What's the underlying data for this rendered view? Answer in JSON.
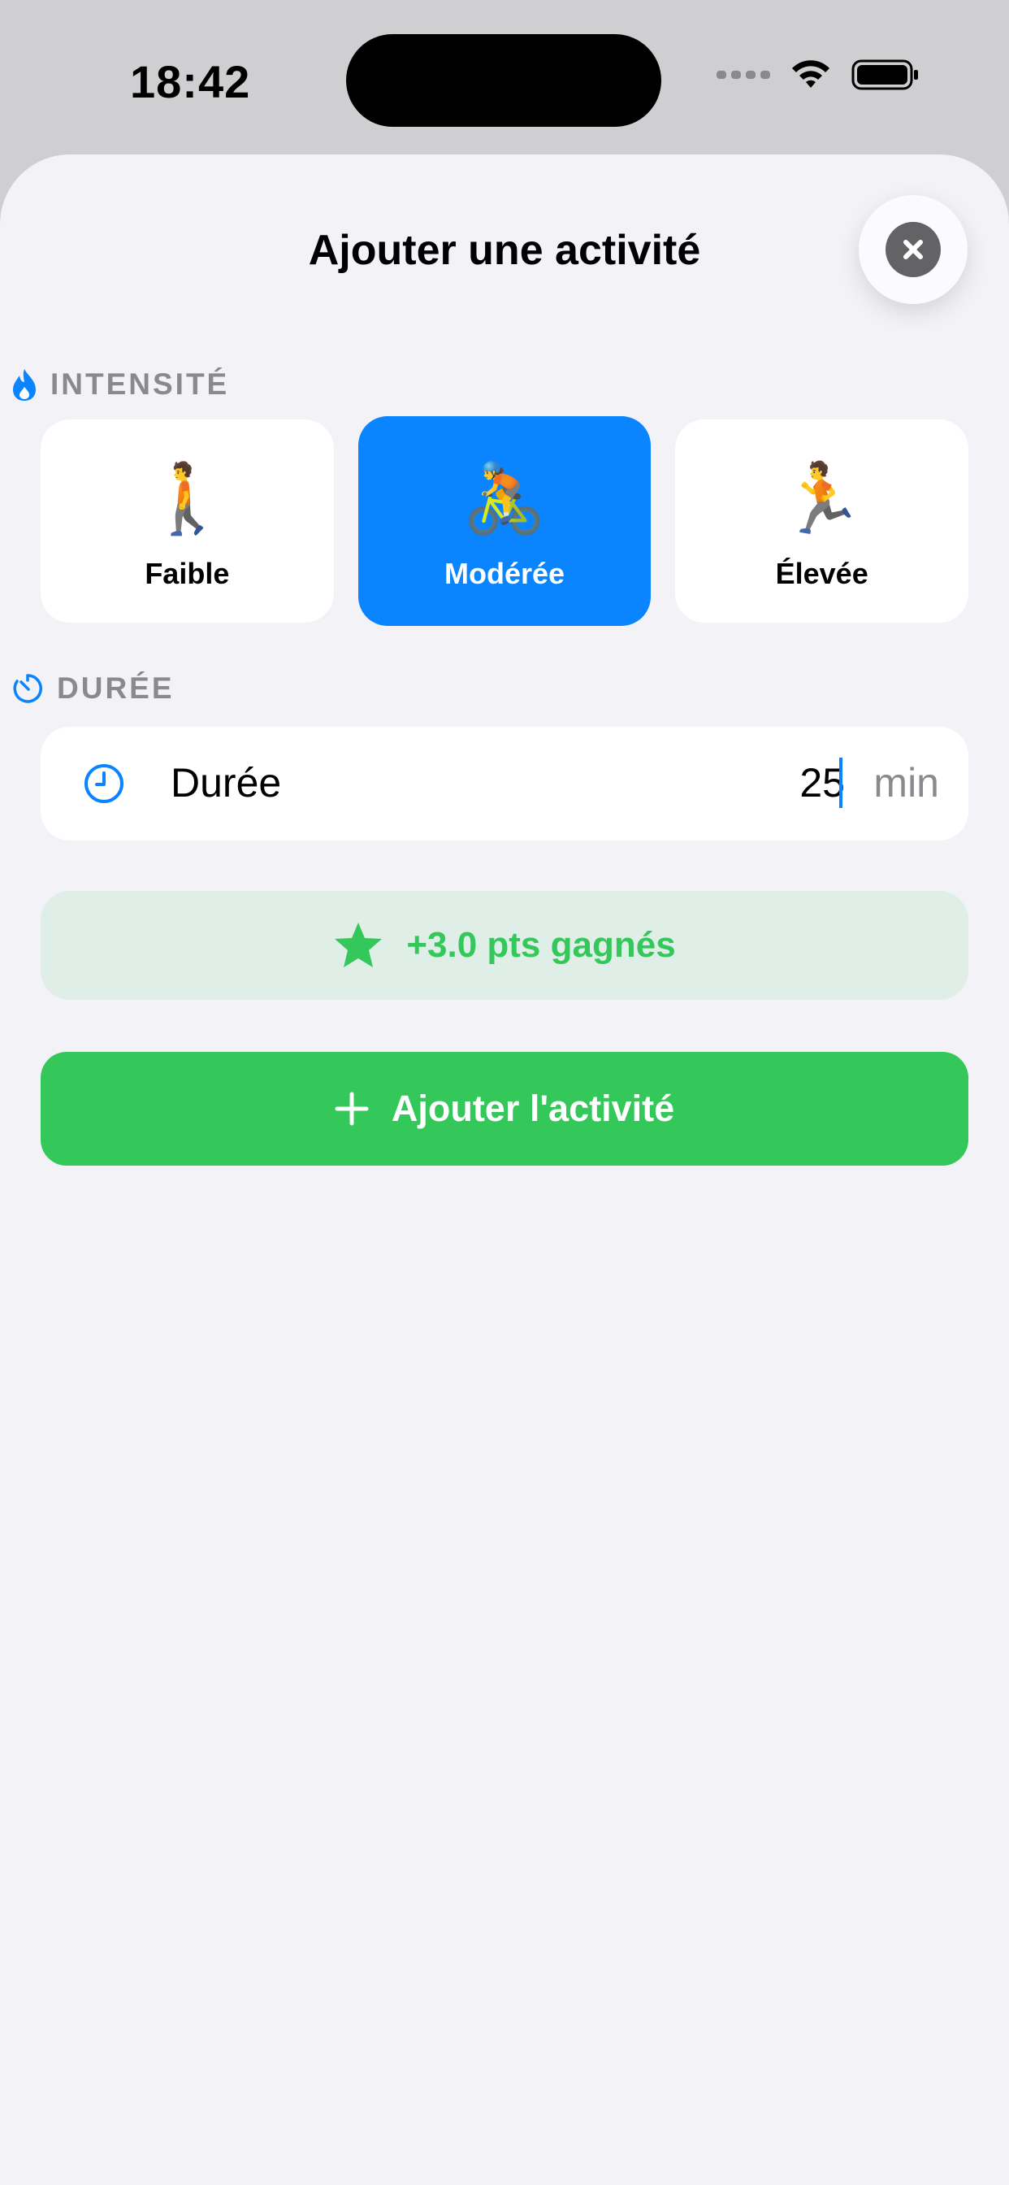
{
  "status_bar": {
    "time": "18:42"
  },
  "sheet": {
    "title": "Ajouter une activité",
    "close_icon": "xmark-circle-icon"
  },
  "intensity_section": {
    "label": "INTENSITÉ",
    "icon": "flame-icon",
    "options": [
      {
        "emoji": "🚶",
        "label": "Faible",
        "selected": false
      },
      {
        "emoji": "🚴",
        "label": "Modérée",
        "selected": true
      },
      {
        "emoji": "🏃",
        "label": "Élevée",
        "selected": false
      }
    ]
  },
  "duration_section": {
    "label": "DURÉE",
    "icon": "timer-icon",
    "field_icon": "clock-icon",
    "field_label": "Durée",
    "value": "25",
    "unit": "min"
  },
  "points": {
    "icon": "star-icon",
    "text": "+3.0 pts gagnés"
  },
  "add_button": {
    "icon": "plus-icon",
    "label": "Ajouter l'activité"
  },
  "colors": {
    "accent": "#0A84FF",
    "success": "#34C759",
    "points_bg": "#DFEEE7",
    "sheet_bg": "#F2F2F7"
  }
}
